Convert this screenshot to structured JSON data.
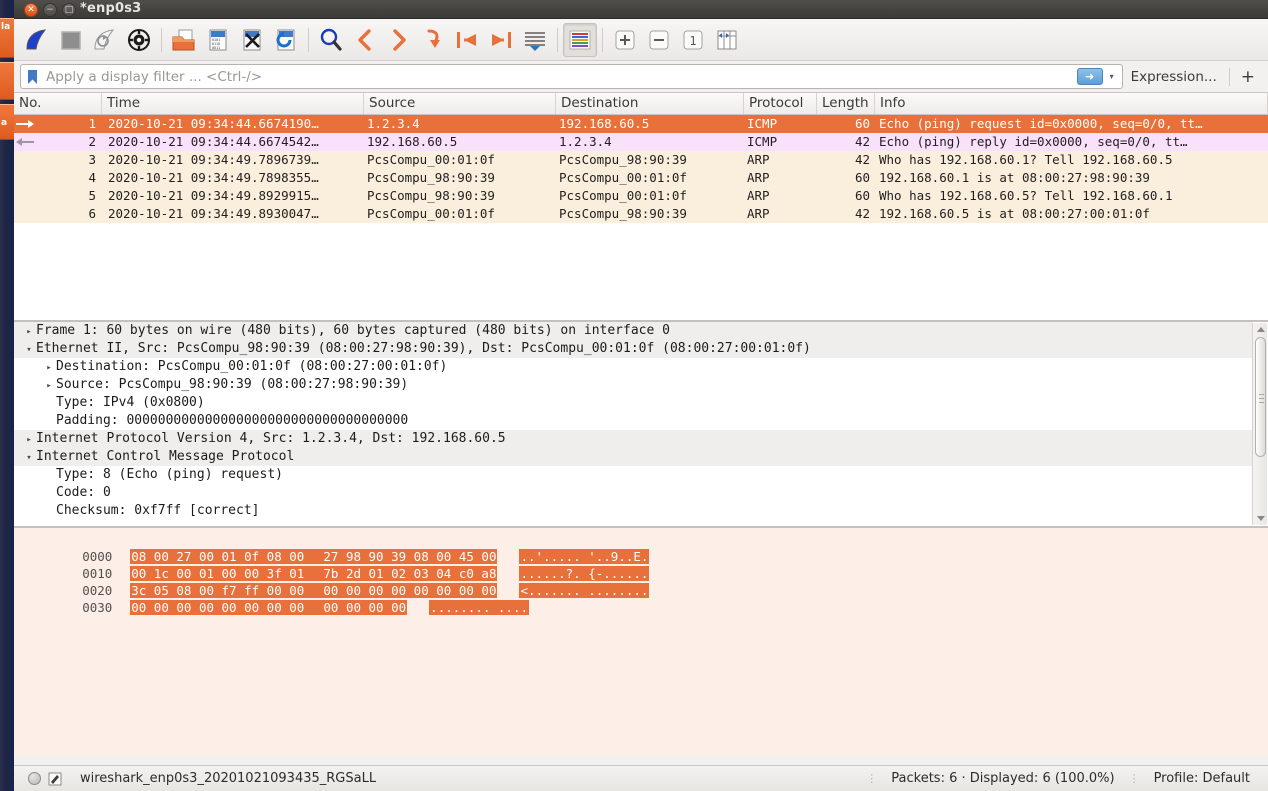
{
  "launcher": {
    "items": [
      {
        "name": "files-app",
        "badge": "la"
      },
      {
        "name": "wireshark-app",
        "badge": "a"
      }
    ]
  },
  "window": {
    "title": "*enp0s3",
    "controls": [
      {
        "name": "close",
        "glyph": "✕"
      },
      {
        "name": "minimize",
        "glyph": "−"
      },
      {
        "name": "maximize",
        "glyph": "□"
      }
    ]
  },
  "toolbar": {
    "buttons": [
      {
        "name": "start-capture-icon",
        "label": "Start capturing packets"
      },
      {
        "name": "stop-capture-icon",
        "label": "Stop capturing packets"
      },
      {
        "name": "restart-capture-icon",
        "label": "Restart current capture"
      },
      {
        "name": "capture-options-icon",
        "label": "Capture options"
      },
      {
        "name": "open-file-icon",
        "label": "Open a capture file"
      },
      {
        "name": "save-file-icon",
        "label": "Save this capture file"
      },
      {
        "name": "close-file-icon",
        "label": "Close this capture file"
      },
      {
        "name": "reload-file-icon",
        "label": "Reload this capture file"
      },
      {
        "name": "find-packet-icon",
        "label": "Find a packet"
      },
      {
        "name": "go-back-icon",
        "label": "Go back in packet history"
      },
      {
        "name": "go-forward-icon",
        "label": "Go forward in packet history"
      },
      {
        "name": "go-to-packet-icon",
        "label": "Go to the packet"
      },
      {
        "name": "go-first-packet-icon",
        "label": "Go to the first packet"
      },
      {
        "name": "go-last-packet-icon",
        "label": "Go to the last packet"
      },
      {
        "name": "autoscroll-icon",
        "label": "Auto scroll in live capture"
      },
      {
        "name": "colorize-icon",
        "label": "Colorize packet list"
      },
      {
        "name": "zoom-in-icon",
        "label": "Zoom in"
      },
      {
        "name": "zoom-out-icon",
        "label": "Zoom out"
      },
      {
        "name": "zoom-reset-icon",
        "label": "Reset layout to default size"
      },
      {
        "name": "resize-columns-icon",
        "label": "Resize columns to fit contents"
      }
    ]
  },
  "filterbar": {
    "placeholder": "Apply a display filter ... <Ctrl-/>",
    "value": "",
    "apply_label": "➜",
    "dropdown_label": "▾",
    "expression_label": "Expression...",
    "plus_label": "+"
  },
  "packet_list": {
    "columns": [
      {
        "key": "no",
        "label": "No."
      },
      {
        "key": "time",
        "label": "Time"
      },
      {
        "key": "src",
        "label": "Source"
      },
      {
        "key": "dst",
        "label": "Destination"
      },
      {
        "key": "proto",
        "label": "Protocol"
      },
      {
        "key": "len",
        "label": "Length"
      },
      {
        "key": "info",
        "label": "Info"
      }
    ],
    "rows": [
      {
        "no": "1",
        "time": "2020-10-21 09:34:44.6674190…",
        "src": "1.2.3.4",
        "dst": "192.168.60.5",
        "proto": "ICMP",
        "len": "60",
        "info": "Echo (ping) request  id=0x0000, seq=0/0, tt…",
        "style": "row-sel",
        "marker": "right-arrow"
      },
      {
        "no": "2",
        "time": "2020-10-21 09:34:44.6674542…",
        "src": "192.168.60.5",
        "dst": "1.2.3.4",
        "proto": "ICMP",
        "len": "42",
        "info": "Echo (ping) reply    id=0x0000, seq=0/0, tt…",
        "style": "row-pink",
        "marker": "left-arrow"
      },
      {
        "no": "3",
        "time": "2020-10-21 09:34:49.7896739…",
        "src": "PcsCompu_00:01:0f",
        "dst": "PcsCompu_98:90:39",
        "proto": "ARP",
        "len": "42",
        "info": "Who has 192.168.60.1? Tell 192.168.60.5",
        "style": "row-tan",
        "marker": ""
      },
      {
        "no": "4",
        "time": "2020-10-21 09:34:49.7898355…",
        "src": "PcsCompu_98:90:39",
        "dst": "PcsCompu_00:01:0f",
        "proto": "ARP",
        "len": "60",
        "info": "192.168.60.1 is at 08:00:27:98:90:39",
        "style": "row-tan",
        "marker": ""
      },
      {
        "no": "5",
        "time": "2020-10-21 09:34:49.8929915…",
        "src": "PcsCompu_98:90:39",
        "dst": "PcsCompu_00:01:0f",
        "proto": "ARP",
        "len": "60",
        "info": "Who has 192.168.60.5? Tell 192.168.60.1",
        "style": "row-tan",
        "marker": ""
      },
      {
        "no": "6",
        "time": "2020-10-21 09:34:49.8930047…",
        "src": "PcsCompu_00:01:0f",
        "dst": "PcsCompu_98:90:39",
        "proto": "ARP",
        "len": "42",
        "info": "192.168.60.5 is at 08:00:27:00:01:0f",
        "style": "row-tan",
        "marker": ""
      }
    ]
  },
  "detail_tree": [
    {
      "indent": 0,
      "tri": "collapsed",
      "shaded": true,
      "text": "Frame 1: 60 bytes on wire (480 bits), 60 bytes captured (480 bits) on interface 0"
    },
    {
      "indent": 0,
      "tri": "expanded",
      "shaded": true,
      "text": "Ethernet II, Src: PcsCompu_98:90:39 (08:00:27:98:90:39), Dst: PcsCompu_00:01:0f (08:00:27:00:01:0f)"
    },
    {
      "indent": 1,
      "tri": "collapsed",
      "shaded": false,
      "text": "Destination: PcsCompu_00:01:0f (08:00:27:00:01:0f)"
    },
    {
      "indent": 1,
      "tri": "collapsed",
      "shaded": false,
      "text": "Source: PcsCompu_98:90:39 (08:00:27:98:90:39)"
    },
    {
      "indent": 1,
      "tri": "none",
      "shaded": false,
      "text": "Type: IPv4 (0x0800)"
    },
    {
      "indent": 1,
      "tri": "none",
      "shaded": false,
      "text": "Padding: 000000000000000000000000000000000000"
    },
    {
      "indent": 0,
      "tri": "collapsed",
      "shaded": true,
      "text": "Internet Protocol Version 4, Src: 1.2.3.4, Dst: 192.168.60.5"
    },
    {
      "indent": 0,
      "tri": "expanded",
      "shaded": true,
      "text": "Internet Control Message Protocol"
    },
    {
      "indent": 1,
      "tri": "none",
      "shaded": false,
      "text": "Type: 8 (Echo (ping) request)"
    },
    {
      "indent": 1,
      "tri": "none",
      "shaded": false,
      "text": "Code: 0"
    },
    {
      "indent": 1,
      "tri": "none",
      "shaded": false,
      "text": "Checksum: 0xf7ff [correct]"
    }
  ],
  "hex_dump": [
    {
      "offset": "0000",
      "bytes_a": "08 00 27 00 01 0f 08 00",
      "bytes_b": "27 98 90 39 08 00 45 00",
      "ascii": "..'..... '..9..E."
    },
    {
      "offset": "0010",
      "bytes_a": "00 1c 00 01 00 00 3f 01",
      "bytes_b": "7b 2d 01 02 03 04 c0 a8",
      "ascii": "......?. {-......"
    },
    {
      "offset": "0020",
      "bytes_a": "3c 05 08 00 f7 ff 00 00",
      "bytes_b": "00 00 00 00 00 00 00 00",
      "ascii": "<....... ........"
    },
    {
      "offset": "0030",
      "bytes_a": "00 00 00 00 00 00 00 00",
      "bytes_b": "00 00 00 00",
      "ascii": "........ ...."
    }
  ],
  "statusbar": {
    "expert_info": "expert-info-indicator",
    "capture_file": "wireshark_enp0s3_20201021093435_RGSaLL",
    "packets": "Packets: 6 · Displayed: 6 (100.0%)",
    "profile": "Profile: Default"
  },
  "colors": {
    "selected_row": "#e8703a",
    "icmp_reply_row": "#f9e0fb",
    "arp_row": "#faeedc",
    "hex_highlight": "#e8703a",
    "hex_pane_bg": "#fdeee7",
    "window_bg": "#f2f1f0",
    "launcher_bg": "#1e2748"
  }
}
